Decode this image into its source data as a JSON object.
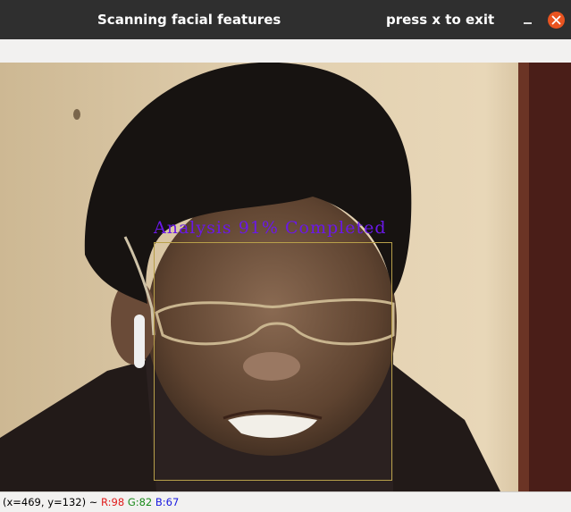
{
  "window": {
    "title": "Scanning facial features",
    "hint": "press x to exit"
  },
  "overlay": {
    "analysis_text": "Analysis 91% Completed",
    "progress_percent": 91,
    "box_color": "#b8a04a",
    "text_color": "#6a18e8"
  },
  "status": {
    "coords": "(x=469, y=132) ~",
    "r": "R:98",
    "g": "G:82",
    "b": "B:67"
  },
  "icons": {
    "minimize": "minimize-icon",
    "close": "close-icon"
  },
  "colors": {
    "close_button": "#e95420",
    "titlebar": "#2f2f2f"
  }
}
